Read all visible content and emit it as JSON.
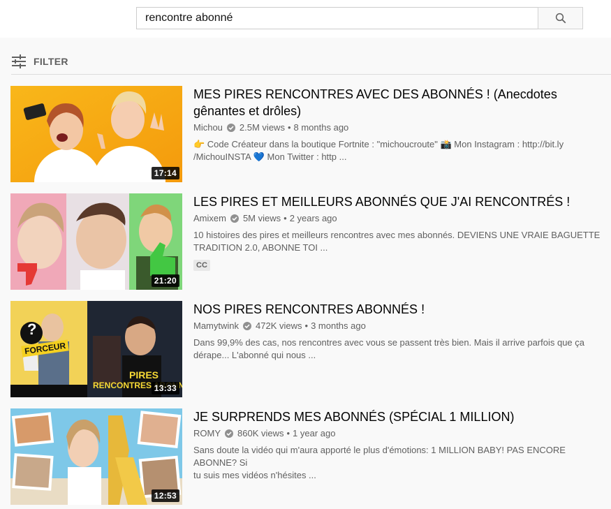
{
  "search": {
    "query": "rencontre abonné"
  },
  "filter": {
    "label": "FILTER"
  },
  "results": [
    {
      "title_line1": "MES PIRES RENCONTRES AVEC DES ABONNÉS ! (Anecdotes",
      "title_line2": "gênantes et drôles)",
      "channel": "Michou",
      "views": "2.5M views",
      "age": "8 months ago",
      "desc_line1": "👉 Code Créateur dans la boutique Fortnite : \"michoucroute\" 📸 Mon Instagram : http://bit.ly",
      "desc_line2": "/MichouINSTA 💙 Mon Twitter : http ...",
      "duration": "17:14"
    },
    {
      "title_line1": "LES PIRES ET MEILLEURS ABONNÉS QUE J'AI RENCONTRÉS !",
      "channel": "Amixem",
      "views": "5M views",
      "age": "2 years ago",
      "desc_line1": "10 histoires des pires et meilleurs rencontres avec mes abonnés. DEVIENS UNE VRAIE BAGUETTE",
      "desc_line2": "TRADITION 2.0, ABONNE TOI ...",
      "badge": "CC",
      "duration": "21:20"
    },
    {
      "title_line1": "NOS PIRES RENCONTRES ABONNÉS !",
      "channel": "Mamytwink",
      "views": "472K views",
      "age": "3 months ago",
      "desc_line1": "Dans 99,9% des cas, nos rencontres avec vous se passent très bien. Mais il arrive parfois que ça",
      "desc_line2": "dérape... L'abonné qui nous ...",
      "duration": "13:33",
      "thumb_text1": "FORCEUR",
      "thumb_text2": "PIRES",
      "thumb_text3": "RENCONTRES ABONNÉS"
    },
    {
      "title_line1": "JE SURPRENDS MES ABONNÉS (SPÉCIAL 1 MILLION)",
      "channel": "ROMY",
      "views": "860K views",
      "age": "1 year ago",
      "desc_line1": "Sans doute la vidéo qui m'aura apporté le plus d'émotions: 1 MILLION BABY! PAS ENCORE ABONNE? Si",
      "desc_line2": "tu suis mes vidéos n'hésites ...",
      "duration": "12:53"
    }
  ],
  "colors": {
    "background": "#f9f9f9",
    "meta_text": "#606060",
    "title_text": "#030303"
  }
}
